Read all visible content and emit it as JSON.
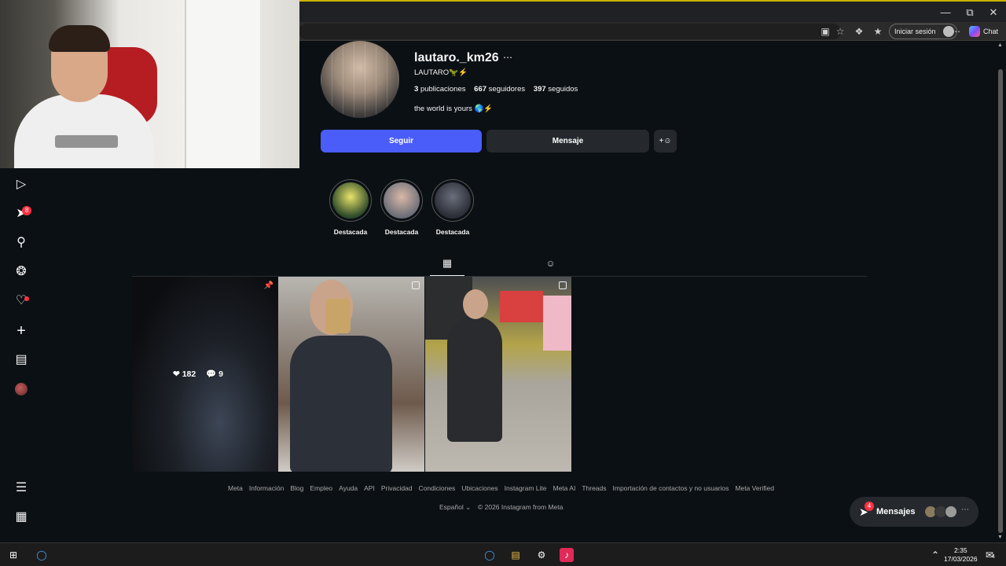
{
  "browser": {
    "signin_label": "Iniciar sesión",
    "chat_label": "Chat"
  },
  "profile": {
    "username": "lautaro._km26",
    "full_name": "LAUTARO🦖⚡",
    "posts_count": "3",
    "posts_label": "publicaciones",
    "followers_count": "667",
    "followers_label": "seguidores",
    "following_count": "397",
    "following_label": "seguidos",
    "bio": "the world is yours 🌎⚡",
    "follow_button": "Seguir",
    "message_button": "Mensaje"
  },
  "highlights": [
    {
      "label": "Destacada"
    },
    {
      "label": "Destacada"
    },
    {
      "label": "Destacada"
    }
  ],
  "posts": [
    {
      "likes": "182",
      "comments": "9",
      "pinned": true
    },
    {
      "multi": true
    },
    {
      "multi": true
    }
  ],
  "sidebar": {
    "notifications_badge": "8"
  },
  "footer": {
    "links": [
      "Meta",
      "Información",
      "Blog",
      "Empleo",
      "Ayuda",
      "API",
      "Privacidad",
      "Condiciones",
      "Ubicaciones",
      "Instagram Lite",
      "Meta AI",
      "Threads",
      "Importación de contactos y no usuarios",
      "Meta Verified"
    ],
    "language": "Español",
    "copyright": "© 2026 Instagram from Meta"
  },
  "messages": {
    "label": "Mensajes",
    "badge": "4"
  },
  "taskbar": {
    "time": "2:35",
    "date": "17/03/2026",
    "notif_count": "4"
  },
  "colors": {
    "follow_button": "#4a5df9",
    "background": "#0b1014",
    "badge": "#ff3040"
  }
}
